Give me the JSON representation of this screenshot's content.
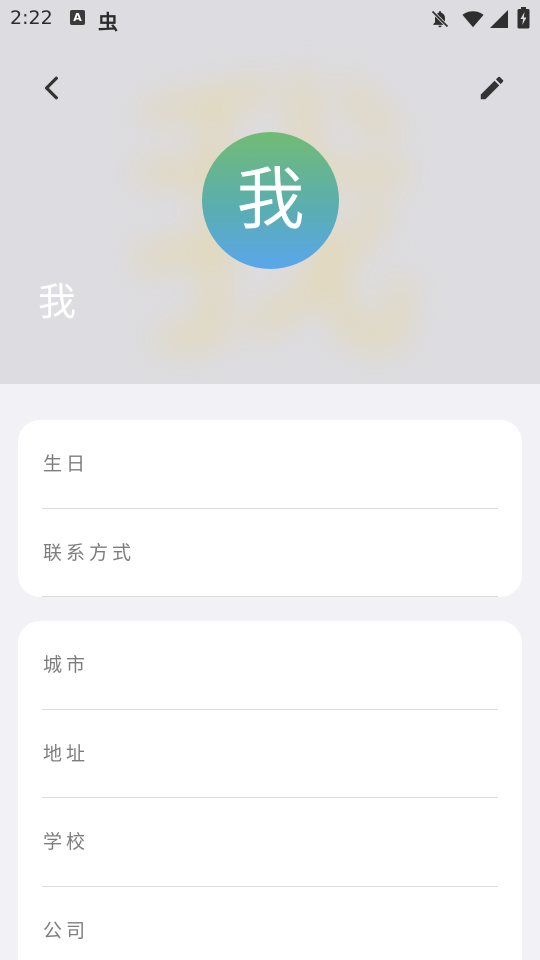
{
  "status_bar": {
    "time": "2:22",
    "left_icons": [
      "a-app-icon",
      "bug-icon"
    ],
    "right_icons": [
      "notifications-off-icon",
      "wifi-icon",
      "cellular-signal-icon",
      "battery-charging-icon"
    ]
  },
  "header": {
    "avatar_text": "我",
    "name": "我",
    "background_glyph": "我",
    "back_icon": "chevron-left-icon",
    "edit_icon": "pencil-icon"
  },
  "cards": [
    {
      "rows": [
        {
          "label": "生日"
        },
        {
          "label": "联系方式"
        }
      ]
    },
    {
      "rows": [
        {
          "label": "城市"
        },
        {
          "label": "地址"
        },
        {
          "label": "学校"
        },
        {
          "label": "公司"
        }
      ]
    }
  ],
  "colors": {
    "header_bg": "#dddce0",
    "page_bg": "#f2f1f6",
    "avatar_gradient_top": "#72bb74",
    "avatar_gradient_bottom": "#5aa6ec",
    "label_text": "#7d7d7d"
  }
}
